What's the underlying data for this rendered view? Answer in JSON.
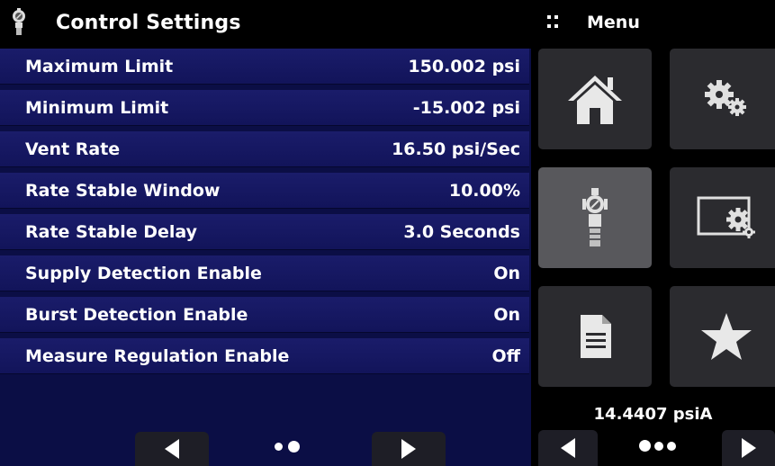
{
  "header": {
    "title": "Control Settings",
    "icon": "regulator-icon"
  },
  "settings": [
    {
      "label": "Maximum Limit",
      "value": "150.002 psi"
    },
    {
      "label": "Minimum Limit",
      "value": "-15.002 psi"
    },
    {
      "label": "Vent Rate",
      "value": "16.50 psi/Sec"
    },
    {
      "label": "Rate Stable Window",
      "value": "10.00%"
    },
    {
      "label": "Rate Stable Delay",
      "value": "3.0 Seconds"
    },
    {
      "label": "Supply Detection Enable",
      "value": "On"
    },
    {
      "label": "Burst Detection Enable",
      "value": "On"
    },
    {
      "label": "Measure Regulation Enable",
      "value": "Off"
    }
  ],
  "left_pager": {
    "prev_icon": "chevron-left-icon",
    "next_icon": "chevron-right-icon",
    "page": 2,
    "pages": 2
  },
  "menu": {
    "title": "Menu",
    "tiles": [
      {
        "name": "home-icon"
      },
      {
        "name": "settings-gears-icon"
      },
      {
        "name": "regulator-icon",
        "active": true
      },
      {
        "name": "display-settings-icon"
      },
      {
        "name": "document-icon"
      },
      {
        "name": "star-icon"
      }
    ]
  },
  "status": {
    "pressure": "14.4407 psiA"
  },
  "right_pager": {
    "prev_icon": "chevron-left-icon",
    "next_icon": "chevron-right-icon",
    "page": 1,
    "pages": 3
  },
  "colors": {
    "row_bg": "#12145a",
    "panel_bg": "#0b0e45",
    "tile_bg": "#2b2b2f",
    "tile_active": "#58585c"
  }
}
